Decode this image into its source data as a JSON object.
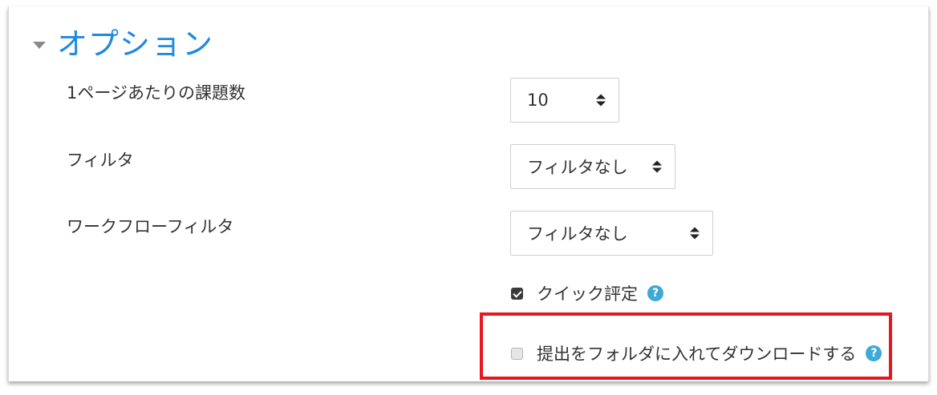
{
  "section": {
    "title": "オプション"
  },
  "fields": {
    "per_page": {
      "label": "1ページあたりの課題数",
      "value": "10"
    },
    "filter": {
      "label": "フィルタ",
      "value": "フィルタなし"
    },
    "workflow_filter": {
      "label": "ワークフローフィルタ",
      "value": "フィルタなし"
    }
  },
  "checkboxes": {
    "quick_grading": {
      "label": "クイック評定",
      "checked": true
    },
    "download_folders": {
      "label": "提出をフォルダに入れてダウンロードする",
      "checked": false
    }
  },
  "help_icon_glyph": "?",
  "colors": {
    "section_title": "#1e88e5",
    "help_icon": "#3fa9d6",
    "highlight_border": "#e8161e"
  },
  "icons": {
    "collapse": "caret-down-icon",
    "select_arrows": "sort-arrows-icon",
    "help": "question-circle-icon"
  }
}
